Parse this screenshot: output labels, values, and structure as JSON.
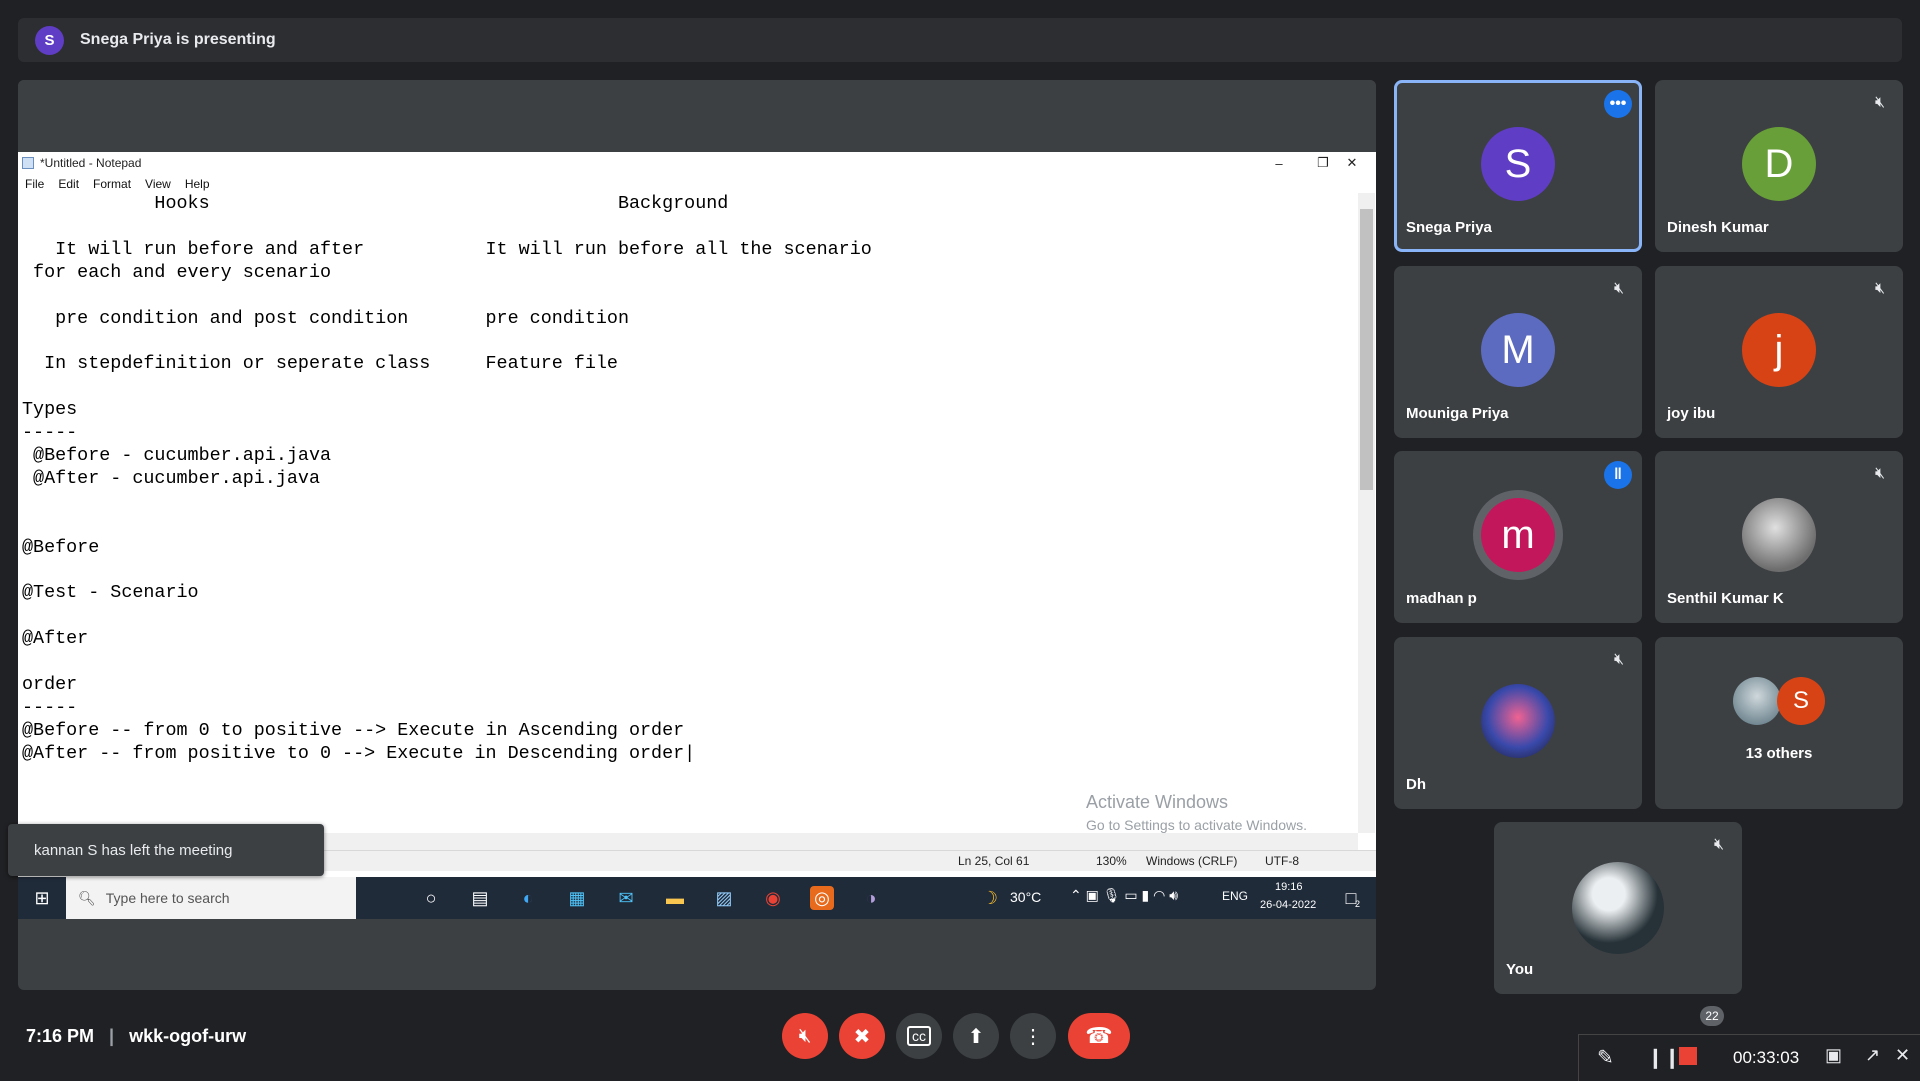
{
  "presenting": {
    "avatar_letter": "S",
    "text": "Snega Priya is presenting"
  },
  "notepad": {
    "title": "*Untitled - Notepad",
    "menu": [
      "File",
      "Edit",
      "Format",
      "View",
      "Help"
    ],
    "lines": [
      "            Hooks                                     Background",
      "",
      "   It will run before and after           It will run before all the scenario",
      " for each and every scenario",
      "",
      "   pre condition and post condition       pre condition",
      "",
      "  In stepdefinition or seperate class     Feature file",
      "",
      "Types",
      "-----",
      " @Before - cucumber.api.java",
      " @After - cucumber.api.java",
      "",
      "",
      "@Before",
      "",
      "@Test - Scenario",
      "",
      "@After",
      "",
      "order",
      "-----",
      "@Before -- from 0 to positive --> Execute in Ascending order",
      "@After -- from positive to 0 --> Execute in Descending order|"
    ],
    "status": {
      "position": "Ln 25, Col 61",
      "zoom": "130%",
      "line_ending": "Windows (CRLF)",
      "encoding": "UTF-8"
    },
    "activate_title": "Activate Windows",
    "activate_sub": "Go to Settings to activate Windows."
  },
  "taskbar": {
    "search_placeholder": "Type here to search",
    "weather": "30°C",
    "lang": "ENG",
    "time": "19:16",
    "date": "26-04-2022",
    "notifications": "2"
  },
  "toast": "kannan S has left the meeting",
  "participants": [
    {
      "letter": "S",
      "name": "Snega Priya",
      "color": "#5f3dc4"
    },
    {
      "letter": "D",
      "name": "Dinesh Kumar",
      "color": "#689f38"
    },
    {
      "letter": "M",
      "name": "Mouniga Priya",
      "color": "#5c6bc0"
    },
    {
      "letter": "j",
      "name": "joy ibu",
      "color": "#d84315"
    },
    {
      "letter": "m",
      "name": "madhan p",
      "color": "#c2185b"
    },
    {
      "letter": "",
      "name": "Senthil Kumar K",
      "color": "#9e9e9e"
    },
    {
      "letter": "",
      "name": "Dh",
      "color": "#3949ab"
    },
    {
      "letter": "S",
      "name": "13 others",
      "color": "#d84315"
    },
    {
      "letter": "",
      "name": "You",
      "color": "#37474f"
    }
  ],
  "meeting": {
    "time": "7:16 PM",
    "code": "wkk-ogof-urw",
    "participant_count": "22"
  },
  "recording": {
    "elapsed": "00:33:03"
  }
}
